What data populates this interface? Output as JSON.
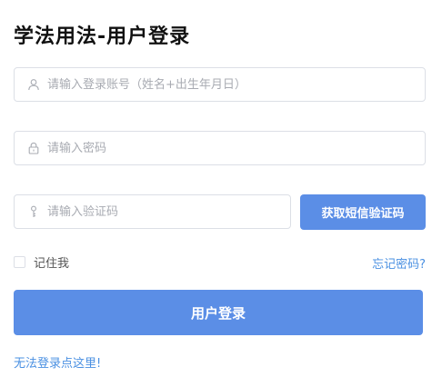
{
  "title": "学法用法-用户登录",
  "form": {
    "account": {
      "icon": "user-icon",
      "placeholder": "请输入登录账号（姓名+出生年月日）",
      "value": ""
    },
    "password": {
      "icon": "lock-icon",
      "placeholder": "请输入密码",
      "value": ""
    },
    "code": {
      "icon": "key-icon",
      "placeholder": "请输入验证码",
      "value": ""
    },
    "get_code_label": "获取短信验证码",
    "remember_label": "记住我",
    "remember_checked": false,
    "forgot_label": "忘记密码?",
    "login_label": "用户登录",
    "cant_login_label": "无法登录点这里!"
  },
  "colors": {
    "primary": "#5b8ee6",
    "link": "#4a90e2",
    "border": "#dcdfe6",
    "placeholder": "#a8abb2"
  }
}
